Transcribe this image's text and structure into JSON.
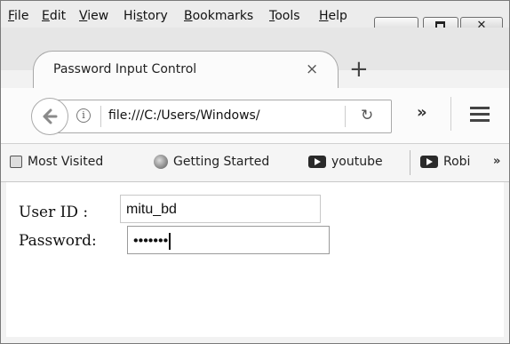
{
  "menubar": {
    "items": [
      {
        "label": "File",
        "accel": "F",
        "rest": "ile"
      },
      {
        "label": "Edit",
        "accel": "E",
        "rest": "dit"
      },
      {
        "label": "View",
        "accel": "V",
        "rest": "iew"
      },
      {
        "label": "History",
        "pre": "Hi",
        "accel": "s",
        "rest": "tory"
      },
      {
        "label": "Bookmarks",
        "accel": "B",
        "rest": "ookmarks"
      },
      {
        "label": "Tools",
        "accel": "T",
        "rest": "ools"
      },
      {
        "label": "Help",
        "accel": "H",
        "rest": "elp"
      }
    ]
  },
  "tab": {
    "title": "Password Input Control",
    "close_glyph": "×",
    "new_tab_glyph": "+"
  },
  "navbar": {
    "url": "file:///C:/Users/Windows/",
    "info_glyph": "i",
    "reload_glyph": "↻",
    "overflow_glyph": "»"
  },
  "bookmarks": {
    "items": [
      {
        "label": "Most Visited",
        "icon": "most-visited-icon"
      },
      {
        "label": "Getting Started",
        "icon": "firefox-icon"
      },
      {
        "label": "youtube",
        "icon": "youtube-icon"
      },
      {
        "label": "Robi",
        "icon": "youtube-icon"
      }
    ],
    "more_glyph": "»"
  },
  "form": {
    "userid_label": "User ID :",
    "userid_value": "mitu_bd",
    "password_label": "Password:",
    "password_masked": "•••••••"
  }
}
